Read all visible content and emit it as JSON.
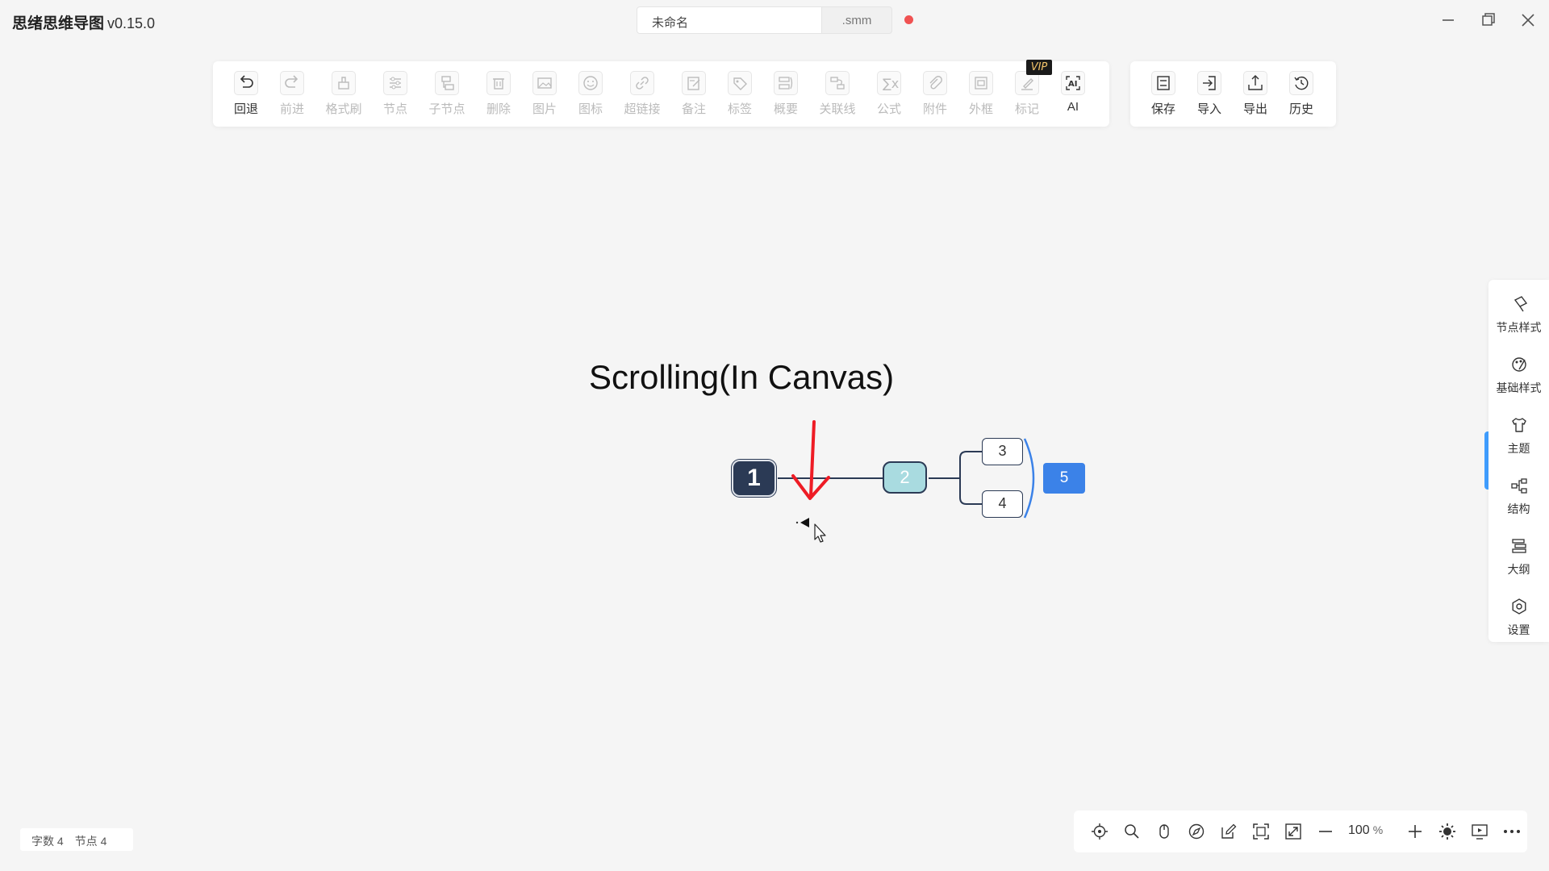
{
  "app": {
    "name": "思绪思维导图",
    "version": "v0.15.0",
    "file_name": "未命名",
    "file_ext": ".smm"
  },
  "toolbar": {
    "items": [
      {
        "label": "回退",
        "icon": "undo-icon",
        "enabled": true
      },
      {
        "label": "前进",
        "icon": "redo-icon",
        "enabled": false
      },
      {
        "label": "格式刷",
        "icon": "format-brush-icon",
        "enabled": false
      },
      {
        "label": "节点",
        "icon": "node-settings-icon",
        "enabled": false
      },
      {
        "label": "子节点",
        "icon": "child-node-icon",
        "enabled": false
      },
      {
        "label": "删除",
        "icon": "trash-icon",
        "enabled": false
      },
      {
        "label": "图片",
        "icon": "image-icon",
        "enabled": false
      },
      {
        "label": "图标",
        "icon": "smiley-icon",
        "enabled": false
      },
      {
        "label": "超链接",
        "icon": "link-icon",
        "enabled": false
      },
      {
        "label": "备注",
        "icon": "note-icon",
        "enabled": false
      },
      {
        "label": "标签",
        "icon": "tag-icon",
        "enabled": false
      },
      {
        "label": "概要",
        "icon": "summary-icon",
        "enabled": false
      },
      {
        "label": "关联线",
        "icon": "association-line-icon",
        "enabled": false
      },
      {
        "label": "公式",
        "icon": "formula-icon",
        "enabled": false
      },
      {
        "label": "附件",
        "icon": "paperclip-icon",
        "enabled": false
      },
      {
        "label": "外框",
        "icon": "outer-frame-icon",
        "enabled": false
      },
      {
        "label": "标记",
        "icon": "marker-pen-icon",
        "enabled": false
      },
      {
        "label": "AI",
        "icon": "ai-icon",
        "enabled": true
      }
    ],
    "vip_badge": "VIP"
  },
  "file_toolbar": {
    "items": [
      {
        "label": "保存",
        "icon": "save-icon"
      },
      {
        "label": "导入",
        "icon": "import-icon"
      },
      {
        "label": "导出",
        "icon": "export-icon"
      },
      {
        "label": "历史",
        "icon": "history-icon"
      }
    ]
  },
  "canvas": {
    "overlay_title": "Scrolling(In Canvas)",
    "nodes": {
      "root": "1",
      "n2": "2",
      "n3": "3",
      "n4": "4",
      "n5": "5"
    },
    "colors": {
      "root_fill": "#2b3a55",
      "n2_fill": "#a9dbe0",
      "n5_fill": "#3b82e8",
      "annotation_arrow": "#ee1c25",
      "summary_bracket": "#3b82e8"
    }
  },
  "side_panel": {
    "items": [
      {
        "label": "节点样式",
        "icon": "node-style-icon"
      },
      {
        "label": "基础样式",
        "icon": "palette-icon"
      },
      {
        "label": "主题",
        "icon": "shirt-icon"
      },
      {
        "label": "结构",
        "icon": "structure-icon"
      },
      {
        "label": "大纲",
        "icon": "outline-icon"
      },
      {
        "label": "设置",
        "icon": "settings-icon"
      }
    ]
  },
  "status": {
    "word_count": "字数 4",
    "node_count": "节点 4"
  },
  "zoom": {
    "value": "100",
    "unit": "%"
  }
}
